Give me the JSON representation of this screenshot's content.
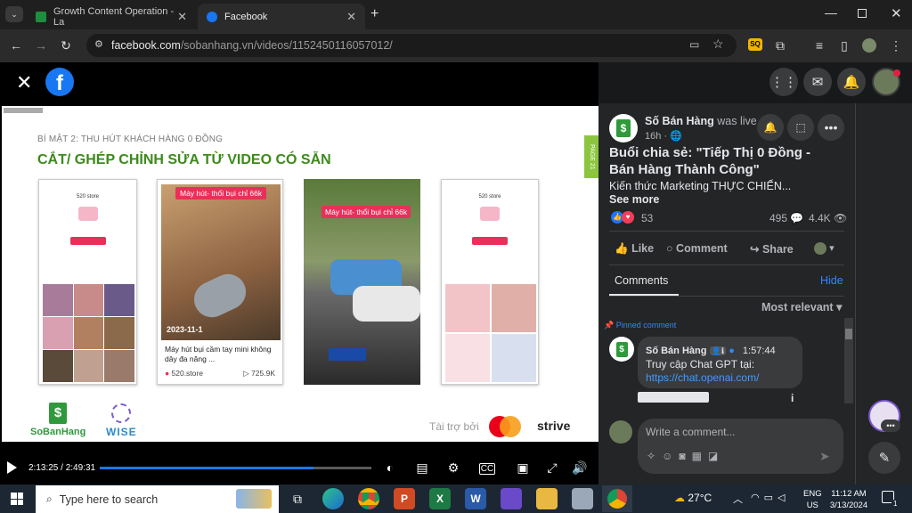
{
  "browser": {
    "tabs": [
      {
        "title": "Growth Content Operation - La",
        "close": "✕"
      },
      {
        "title": "Facebook",
        "close": "✕"
      }
    ],
    "new_tab": "+",
    "url_domain": "facebook.com",
    "url_path": "/sobanhang.vn/videos/1152450116057012/"
  },
  "slide": {
    "header_small": "BÍ MẬT 2: THU HÚT KHÁCH HÀNG 0 ĐỒNG",
    "title": "CẮT/ GHÉP CHỈNH SỬA TỪ VIDEO CÓ SẴN",
    "page_tab": "PAGE 21",
    "phone1_store": "520 store",
    "video_tag": "Máy hút- thổi bụi chỉ 66k",
    "video_date": "2023-11-1",
    "video_caption": "Máy hút bụi cầm tay mini không dây đa năng ...",
    "video_account": "520.store",
    "video_views": "725.9K",
    "video2_tag": "Máy hút- thổi bụi chỉ 66k",
    "phone4_store": "520 store",
    "logo_sobanhang": "SoBanHang",
    "logo_wise": "WISE",
    "sponsor_label": "Tài trợ bởi",
    "sponsor_strive": "strive"
  },
  "player": {
    "time_current": "2:13:25",
    "time_total": "2:49:31",
    "progress": 0.787
  },
  "post": {
    "page_name": "Số Bán Hàng",
    "live_text": "was live.",
    "time_ago": "16h",
    "title": "Buổi chia sẻ: \"Tiếp Thị 0 Đồng - Bán Hàng Thành Công\"",
    "subtitle": "Kiến thức Marketing THỰC CHIẾN...",
    "see_more": "See more",
    "reactions_count": "53",
    "comments_count": "495",
    "views_count": "4.4K",
    "like": "Like",
    "comment": "Comment",
    "share": "Share",
    "comments_tab": "Comments",
    "hide": "Hide",
    "sort": "Most relevant",
    "pinned": "Pinned comment",
    "c_author": "Số Bán Hàng",
    "c_time": "1:57:44",
    "c_text": "Truy cập Chat GPT tại:",
    "c_link": "https://chat.openai.com/",
    "write_placeholder": "Write a comment..."
  },
  "taskbar": {
    "search_placeholder": "Type here to search",
    "weather": "27°C",
    "lang1": "ENG",
    "lang2": "US",
    "clock_time": "11:12 AM",
    "clock_date": "3/13/2024",
    "notif_count": "1"
  },
  "colors": {
    "fb_blue": "#1877f2",
    "slide_green": "#3c8a1a",
    "pink": "#e8305a"
  }
}
